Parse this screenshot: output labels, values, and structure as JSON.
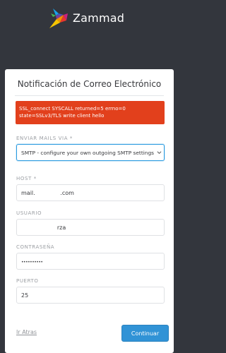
{
  "brand": {
    "name": "Zammad",
    "icon": "zammad-bird-logo"
  },
  "card": {
    "title": "Notificación de Correo Electrónico"
  },
  "error": {
    "line1": "SSL_connect SYSCALL returned=5 errno=0",
    "line2": "state=SSLv3/TLS write client hello"
  },
  "form": {
    "send_via": {
      "label": "ENVIAR MAILS VIA *",
      "value": "SMTP - configure your own outgoing SMTP settings",
      "icon": "chevron-down-icon"
    },
    "host": {
      "label": "HOST *",
      "value": "mail.              .com"
    },
    "user": {
      "label": "USUARIO",
      "value": "                    rza"
    },
    "password": {
      "label": "CONTRASEÑA",
      "value": "••••••••••"
    },
    "port": {
      "label": "PUERTO",
      "value": "25"
    }
  },
  "actions": {
    "back": "Ir Atras",
    "continue": "Continuar"
  },
  "colors": {
    "background": "#33363d",
    "error": "#e2401c",
    "primary": "#3193d6",
    "focus": "#2b9be0"
  }
}
